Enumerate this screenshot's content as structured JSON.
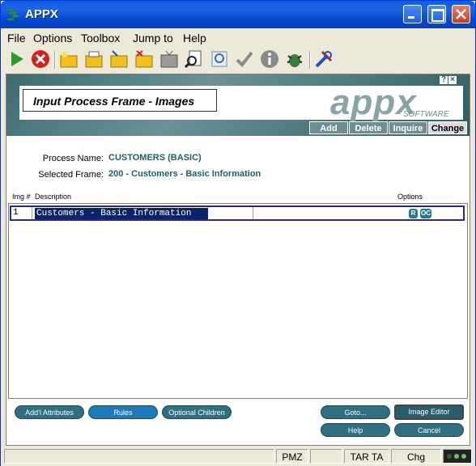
{
  "window": {
    "title": "APPX"
  },
  "menu": [
    "File",
    "Options",
    "Toolbox",
    "Jump to",
    "Help"
  ],
  "toolbar_icons": [
    "go-icon",
    "cancel-icon",
    "new-folder-icon",
    "folder-edit-icon",
    "folder-open-icon",
    "folder-delete-icon",
    "tv-icon",
    "search-doc-icon",
    "zoom-icon",
    "check-icon",
    "info-icon",
    "bug-icon",
    "tools-icon"
  ],
  "frame": {
    "title": "Input Process Frame - Images",
    "logo": "appx",
    "logo_sub": "SOFTWARE",
    "help_icons": [
      "?",
      "×"
    ],
    "modes": [
      "Add",
      "Delete",
      "Inquire",
      "Change"
    ],
    "active_mode": "Change"
  },
  "fields": {
    "process_name_label": "Process Name:",
    "process_name_value": "CUSTOMERS (BASIC)",
    "selected_frame_label": "Selected Frame:",
    "selected_frame_value": "200 - Customers - Basic Information"
  },
  "table": {
    "headers": {
      "img": "Img #",
      "desc": "Description",
      "options": "Options"
    },
    "rows": [
      {
        "img": "1",
        "desc": "Customers - Basic Information",
        "options": [
          "R",
          "OC"
        ]
      }
    ]
  },
  "buttons": {
    "addl_attributes": "Add'l Attributes",
    "rules": "Rules",
    "optional_children": "Optional Children",
    "goto": "Goto...",
    "image_editor": "Image Editor",
    "help": "Help",
    "cancel": "Cancel"
  },
  "status": {
    "pmz": "PMZ",
    "tarta": "TAR TA",
    "chg": "Chg"
  },
  "colors": {
    "title_bar": "#0a5fe0",
    "banner": "#3e6a6e",
    "pill": "#2f6f80",
    "selection": "#0a246a"
  }
}
